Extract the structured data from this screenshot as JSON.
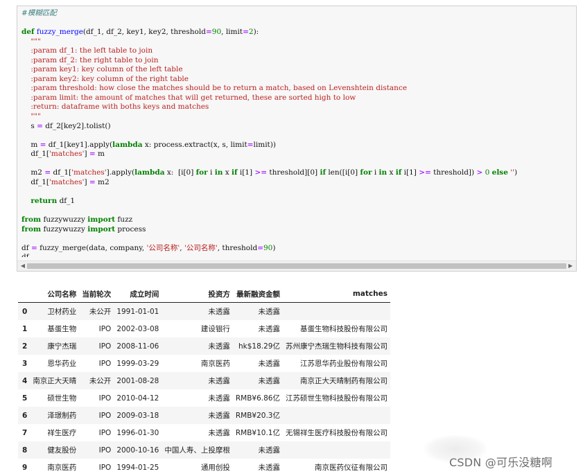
{
  "code_cell": {
    "lines": [
      [
        {
          "t": "#模糊匹配",
          "c": "comment"
        }
      ],
      [],
      [
        {
          "t": "def",
          "c": "kw"
        },
        {
          "t": " "
        },
        {
          "t": "fuzzy_merge",
          "c": "def"
        },
        {
          "t": "(df_1, df_2, key1, key2, threshold"
        },
        {
          "t": "=",
          "c": "op"
        },
        {
          "t": "90",
          "c": "num"
        },
        {
          "t": ", limit"
        },
        {
          "t": "=",
          "c": "op"
        },
        {
          "t": "2",
          "c": "num"
        },
        {
          "t": "):"
        }
      ],
      [
        {
          "t": "    \"\"\"",
          "c": "str"
        }
      ],
      [
        {
          "t": "    :param df_1: the left table to join",
          "c": "str"
        }
      ],
      [
        {
          "t": "    :param df_2: the right table to join",
          "c": "str"
        }
      ],
      [
        {
          "t": "    :param key1: key column of the left table",
          "c": "str"
        }
      ],
      [
        {
          "t": "    :param key2: key column of the right table",
          "c": "str"
        }
      ],
      [
        {
          "t": "    :param threshold: how close the matches should be to return a match, based on Levenshtein distance",
          "c": "str"
        }
      ],
      [
        {
          "t": "    :param limit: the amount of matches that will get returned, these are sorted high to low",
          "c": "str"
        }
      ],
      [
        {
          "t": "    :return: dataframe with boths keys and matches",
          "c": "str"
        }
      ],
      [
        {
          "t": "    \"\"\"",
          "c": "str"
        }
      ],
      [
        {
          "t": "    s "
        },
        {
          "t": "=",
          "c": "op"
        },
        {
          "t": " df_2[key2].tolist()"
        }
      ],
      [],
      [
        {
          "t": "    m "
        },
        {
          "t": "=",
          "c": "op"
        },
        {
          "t": " df_1[key1].apply("
        },
        {
          "t": "lambda",
          "c": "kw"
        },
        {
          "t": " x: process.extract(x, s, limit"
        },
        {
          "t": "=",
          "c": "op"
        },
        {
          "t": "limit))"
        }
      ],
      [
        {
          "t": "    df_1["
        },
        {
          "t": "'matches'",
          "c": "str"
        },
        {
          "t": "] "
        },
        {
          "t": "=",
          "c": "op"
        },
        {
          "t": " m"
        }
      ],
      [],
      [
        {
          "t": "    m2 "
        },
        {
          "t": "=",
          "c": "op"
        },
        {
          "t": " df_1["
        },
        {
          "t": "'matches'",
          "c": "str"
        },
        {
          "t": "].apply("
        },
        {
          "t": "lambda",
          "c": "kw"
        },
        {
          "t": " x:  [i[0] "
        },
        {
          "t": "for",
          "c": "kw"
        },
        {
          "t": " i "
        },
        {
          "t": "in",
          "c": "kw"
        },
        {
          "t": " x "
        },
        {
          "t": "if",
          "c": "kw"
        },
        {
          "t": " i[1] "
        },
        {
          "t": ">=",
          "c": "op"
        },
        {
          "t": " threshold][0] "
        },
        {
          "t": "if",
          "c": "kw"
        },
        {
          "t": " len([i[0] "
        },
        {
          "t": "for",
          "c": "kw"
        },
        {
          "t": " i "
        },
        {
          "t": "in",
          "c": "kw"
        },
        {
          "t": " x "
        },
        {
          "t": "if",
          "c": "kw"
        },
        {
          "t": " i[1] "
        },
        {
          "t": ">=",
          "c": "op"
        },
        {
          "t": " threshold]) "
        },
        {
          "t": ">",
          "c": "op"
        },
        {
          "t": " "
        },
        {
          "t": "0",
          "c": "num"
        },
        {
          "t": " "
        },
        {
          "t": "else",
          "c": "kw"
        },
        {
          "t": " "
        },
        {
          "t": "''",
          "c": "str"
        },
        {
          "t": ")"
        }
      ],
      [
        {
          "t": "    df_1["
        },
        {
          "t": "'matches'",
          "c": "str"
        },
        {
          "t": "] "
        },
        {
          "t": "=",
          "c": "op"
        },
        {
          "t": " m2"
        }
      ],
      [],
      [
        {
          "t": "    "
        },
        {
          "t": "return",
          "c": "kw"
        },
        {
          "t": " df_1"
        }
      ],
      [],
      [
        {
          "t": "from",
          "c": "kw"
        },
        {
          "t": " fuzzywuzzy "
        },
        {
          "t": "import",
          "c": "kw"
        },
        {
          "t": " fuzz"
        }
      ],
      [
        {
          "t": "from",
          "c": "kw"
        },
        {
          "t": " fuzzywuzzy "
        },
        {
          "t": "import",
          "c": "kw"
        },
        {
          "t": " process"
        }
      ],
      [],
      [
        {
          "t": "df "
        },
        {
          "t": "=",
          "c": "op"
        },
        {
          "t": " fuzzy_merge(data, company, "
        },
        {
          "t": "'公司名称'",
          "c": "str"
        },
        {
          "t": ", "
        },
        {
          "t": "'公司名称'",
          "c": "str"
        },
        {
          "t": ", threshold"
        },
        {
          "t": "=",
          "c": "op"
        },
        {
          "t": "90",
          "c": "num"
        },
        {
          "t": ")"
        }
      ],
      [
        {
          "t": "df"
        }
      ]
    ]
  },
  "scrollbar": {
    "left_arrow": "◀",
    "right_arrow": "▶"
  },
  "table": {
    "columns": [
      "",
      "公司名称",
      "当前轮次",
      "成立时间",
      "投资方",
      "最新融资金额",
      "matches"
    ],
    "rows": [
      [
        "0",
        "卫材药业",
        "未公开",
        "1991-01-01",
        "未透露",
        "未透露",
        ""
      ],
      [
        "1",
        "基蛋生物",
        "IPO",
        "2002-03-08",
        "建设银行",
        "未透露",
        "基蛋生物科技股份有限公司"
      ],
      [
        "2",
        "康宁杰瑞",
        "IPO",
        "2008-11-06",
        "未透露",
        "hk$18.29亿",
        "苏州康宁杰瑞生物科技有限公司"
      ],
      [
        "3",
        "恩华药业",
        "IPO",
        "1999-03-29",
        "南京医药",
        "未透露",
        "江苏恩华药业股份有限公司"
      ],
      [
        "4",
        "南京正大天晴",
        "未公开",
        "2001-08-28",
        "未透露",
        "未透露",
        "南京正大天晴制药有限公司"
      ],
      [
        "5",
        "硕世生物",
        "IPO",
        "2010-04-12",
        "未透露",
        "RMB¥6.86亿",
        "江苏硕世生物科技股份有限公司"
      ],
      [
        "6",
        "泽璟制药",
        "IPO",
        "2009-03-18",
        "未透露",
        "RMB¥20.3亿",
        ""
      ],
      [
        "7",
        "祥生医疗",
        "IPO",
        "1996-01-30",
        "未透露",
        "RMB¥10.1亿",
        "无锡祥生医疗科技股份有限公司"
      ],
      [
        "8",
        "健友股份",
        "IPO",
        "2000-10-16",
        "中国人寿、上投摩根",
        "未透露",
        ""
      ],
      [
        "9",
        "南京医药",
        "IPO",
        "1994-01-25",
        "通用创投",
        "未透露",
        "南京医药仪征有限公司"
      ]
    ]
  },
  "watermark": "CSDN @可乐没糖啊"
}
